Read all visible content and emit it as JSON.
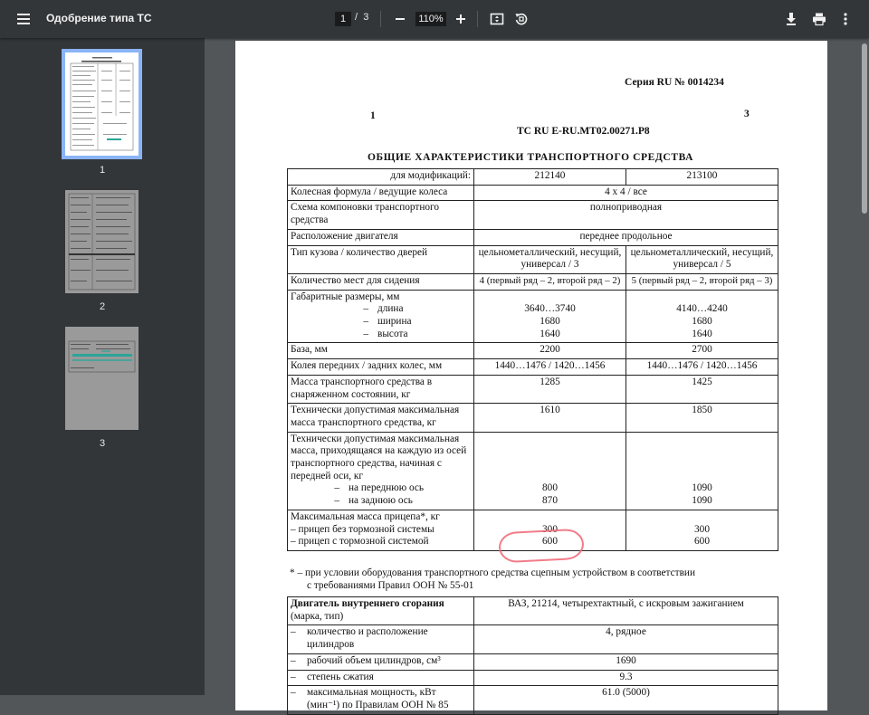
{
  "toolbar": {
    "title": "Одобрение типа ТС",
    "current_page": "1",
    "page_separator": "/",
    "total_pages": "3",
    "zoom": "110%"
  },
  "thumbnails": [
    {
      "label": "1",
      "selected": true
    },
    {
      "label": "2",
      "selected": false
    },
    {
      "label": "3",
      "selected": false
    }
  ],
  "document": {
    "serial": "Серия RU № 0014234",
    "page_left": "1",
    "page_right": "3",
    "cert_number": "ТС RU E-RU.МТ02.00271.Р8",
    "heading": "ОБЩИЕ  ХАРАКТЕРИСТИКИ  ТРАНСПОРТНОГО  СРЕДСТВА",
    "table": {
      "mod_label": "для модификаций:",
      "mod_a": "212140",
      "mod_b": "213100",
      "wheel_formula_label": "Колесная формула / ведущие колеса",
      "wheel_formula_value": "4 x 4 / все",
      "layout_label": "Схема компоновки транспортного средства",
      "layout_value": "полноприводная",
      "engine_pos_label": "Расположение двигателя",
      "engine_pos_value": "переднее продольное",
      "body_label": "Тип кузова / количество дверей",
      "body_a": "цельнометаллический, несущий, универсал / 3",
      "body_b": "цельнометаллический, несущий, универсал / 5",
      "seats_label": "Количество мест для сидения",
      "seats_a": "4 (первый ряд – 2, второй ряд – 2)",
      "seats_b": "5 (первый ряд – 2, второй ряд – 3)",
      "dims_label": "Габаритные размеры, мм",
      "dim_dash": "–",
      "length_label": "длина",
      "width_label": "ширина",
      "height_label": "высота",
      "length_a": "3640…3740",
      "width_a": "1680",
      "height_a": "1640",
      "length_b": "4140…4240",
      "width_b": "1680",
      "height_b": "1640",
      "base_label": "База, мм",
      "base_a": "2200",
      "base_b": "2700",
      "track_label": "Колея  передних / задних колес, мм",
      "track_a": "1440…1476 / 1420…1456",
      "track_b": "1440…1476 / 1420…1456",
      "curb_label": "Масса транспортного средства в снаряженном состоянии, кг",
      "curb_a": "1285",
      "curb_b": "1425",
      "max_mass_label": "Технически допустимая максимальная масса транспортного средства, кг",
      "max_mass_a": "1610",
      "max_mass_b": "1850",
      "axle_label": "Технически допустимая максимальная масса, приходящаяся на каждую из осей транспортного средства, начиная с передней оси, кг",
      "front_axle_label": "на переднюю ось",
      "rear_axle_label": "на заднюю ось",
      "front_axle_a": "800",
      "rear_axle_a": "870",
      "front_axle_b": "1090",
      "rear_axle_b": "1090",
      "trailer_label": "Максимальная масса прицепа*, кг",
      "trailer_nobrake_label": "– прицеп без тормозной системы",
      "trailer_brake_label": "– прицеп с тормозной системой",
      "trailer_nobrake_a": "300",
      "trailer_brake_a": "600",
      "trailer_nobrake_b": "300",
      "trailer_brake_b": "600"
    },
    "footnote_line1": "* – при условии оборудования транспортного средства сцепным устройством в соответствии",
    "footnote_line2": "с требованиями Правил ООН № 55-01",
    "engine_table": {
      "engine_label": "Двигатель внутреннего сгорания",
      "engine_sub": "(марка, тип)",
      "engine_value": "ВАЗ, 21214, четырехтактный, с искровым зажиганием",
      "row_dash": "–",
      "cyl_label": "количество и расположение цилиндров",
      "cyl_value": "4, рядное",
      "disp_label": "рабочий объем цилиндров, см³",
      "disp_value": "1690",
      "comp_label": "степень сжатия",
      "comp_value": "9.3",
      "power_label": "максимальная мощность, кВт (мин⁻¹) по Правилам ООН № 85",
      "power_value": "61.0 (5000)"
    }
  },
  "colors": {
    "toolbar_bg": "#323639",
    "viewer_bg": "#525659",
    "selection": "#8ab4f8",
    "annotation": "#ef6e7c"
  },
  "icons": [
    "menu-icon",
    "zoom-out-icon",
    "zoom-in-icon",
    "fit-page-icon",
    "rotate-icon",
    "download-icon",
    "print-icon",
    "more-vert-icon"
  ]
}
